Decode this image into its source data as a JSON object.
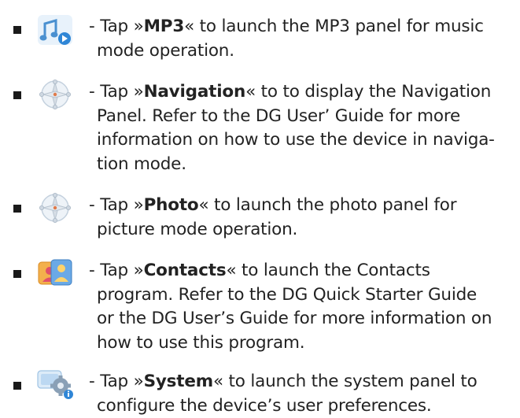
{
  "items": [
    {
      "icon": "mp3-music-note-icon",
      "pre": "- Tap »",
      "key": "MP3",
      "lines": [
        "« to launch the MP3 panel for music",
        "mode operation."
      ]
    },
    {
      "icon": "navigation-compass-icon",
      "pre": "- Tap »",
      "key": "Navigation",
      "lines": [
        "« to to display the Navigation",
        "Panel. Refer to the DG User’ Guide for more",
        "information on how to use the device in naviga-",
        "tion mode."
      ]
    },
    {
      "icon": "photo-compass-icon",
      "pre": "- Tap »",
      "key": "Photo",
      "lines": [
        "« to launch the photo panel for",
        "picture mode operation."
      ]
    },
    {
      "icon": "contacts-card-icon",
      "pre": "- Tap »",
      "key": "Contacts",
      "lines": [
        "« to launch the Contacts",
        "program. Refer to the DG Quick Starter Guide",
        "or the DG User’s Guide for more information on",
        "how to use this program."
      ]
    },
    {
      "icon": "system-settings-gear-icon",
      "pre": "- Tap »",
      "key": "System",
      "lines": [
        "« to launch the system panel to",
        "configure the device’s user preferences."
      ]
    }
  ]
}
